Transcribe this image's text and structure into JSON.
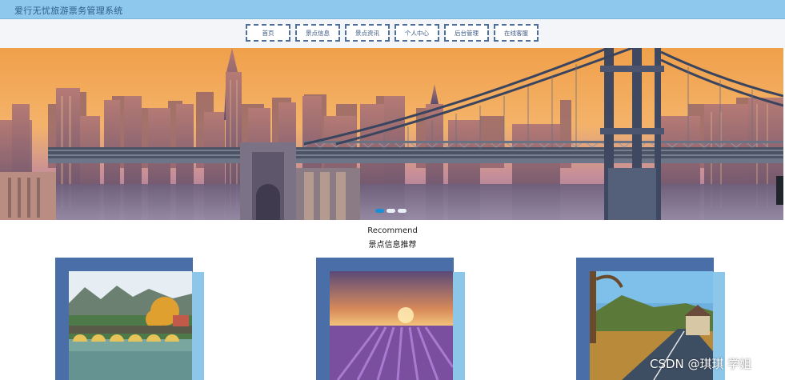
{
  "header": {
    "title": "爱行无忧旅游票务管理系统"
  },
  "nav": {
    "items": [
      {
        "label": "首页"
      },
      {
        "label": "景点信息"
      },
      {
        "label": "景点资讯"
      },
      {
        "label": "个人中心"
      },
      {
        "label": "后台管理"
      },
      {
        "label": "在线客服"
      }
    ]
  },
  "banner": {
    "slide_count": 3,
    "active_slide": 1
  },
  "section": {
    "title_en": "Recommend",
    "title_zh": "景点信息推荐"
  },
  "watermark": "CSDN @琪琪 学姐",
  "colors": {
    "header_bg": "#8ec8ec",
    "nav_border": "#4f6f9f",
    "card_dark": "#4a6fa8",
    "card_light": "#8cc7ea",
    "dot_active": "#1a8fd6"
  }
}
